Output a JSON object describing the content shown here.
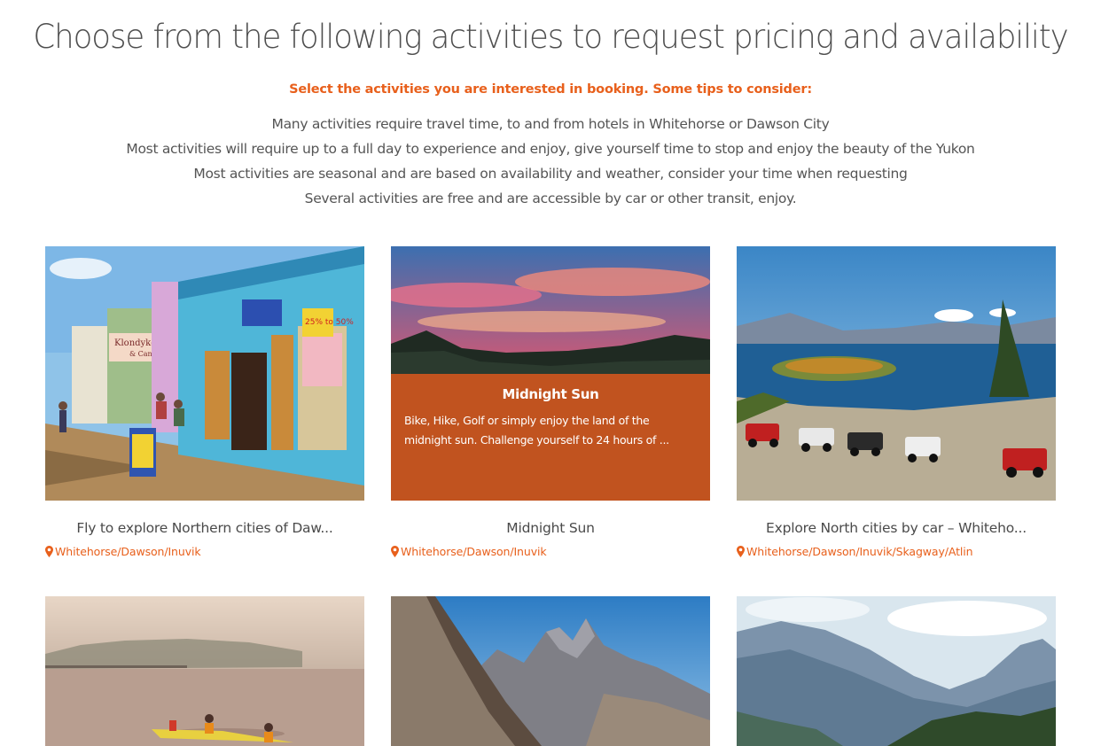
{
  "header": {
    "title": "Choose from the following activities to request pricing and availability",
    "subtitle": "Select the activities you are interested in booking. Some tips to consider:",
    "tips": [
      "Many activities require travel time, to and from hotels in Whitehorse or Dawson City",
      "Most activities will require up to a full day to experience and enjoy, give yourself time to stop and enjoy the beauty of the Yukon",
      "Most activities are seasonal and are based on availability and weather, consider your time when requesting",
      "Several activities are free and are accessible by car or other transit, enjoy."
    ]
  },
  "accent_color": "#e8601c",
  "activities": [
    {
      "title": "Fly to explore Northern cities of Daw...",
      "location": "Whitehorse/Dawson/Inuvik",
      "icon": "map-marker-icon"
    },
    {
      "title": "Midnight Sun",
      "location": "Whitehorse/Dawson/Inuvik",
      "icon": "map-marker-icon",
      "overlay": {
        "title": "Midnight Sun",
        "text": "Bike, Hike, Golf or simply enjoy the land of the midnight sun. Challenge yourself to 24 hours of ..."
      }
    },
    {
      "title": "Explore North cities by car – Whiteho...",
      "location": "Whitehorse/Dawson/Inuvik/Skagway/Atlin",
      "icon": "map-marker-icon"
    },
    {},
    {},
    {}
  ]
}
